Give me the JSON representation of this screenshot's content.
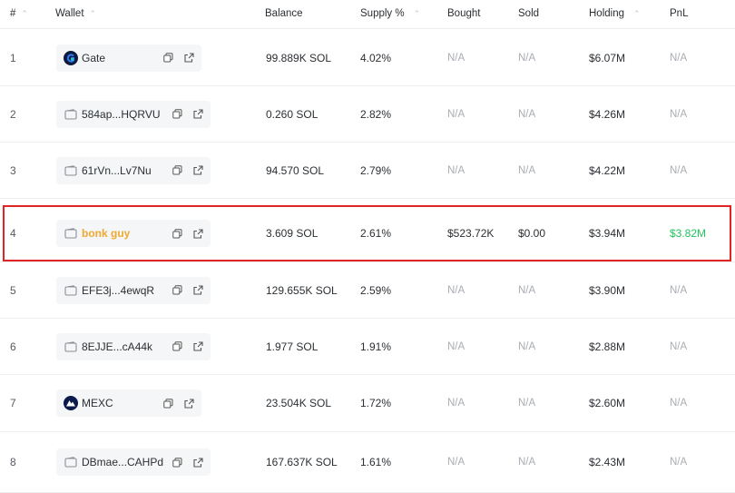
{
  "header": {
    "index": "#",
    "wallet": "Wallet",
    "balance": "Balance",
    "supply": "Supply %",
    "bought": "Bought",
    "sold": "Sold",
    "holding": "Holding",
    "pnl": "PnL"
  },
  "rows": [
    {
      "index": "1",
      "wallet": "Gate",
      "icon": "gate-logo-icon",
      "balance": "99.889K SOL",
      "supply": "4.02%",
      "bought": "N/A",
      "sold": "N/A",
      "holding": "$6.07M",
      "pnl": "N/A"
    },
    {
      "index": "2",
      "wallet": "584ap...HQRVU",
      "icon": "wallet-icon",
      "balance": "0.260 SOL",
      "supply": "2.82%",
      "bought": "N/A",
      "sold": "N/A",
      "holding": "$4.26M",
      "pnl": "N/A"
    },
    {
      "index": "3",
      "wallet": "61rVn...Lv7Nu",
      "icon": "wallet-icon",
      "balance": "94.570 SOL",
      "supply": "2.79%",
      "bought": "N/A",
      "sold": "N/A",
      "holding": "$4.22M",
      "pnl": "N/A"
    },
    {
      "index": "4",
      "wallet": "bonk guy",
      "icon": "wallet-icon",
      "balance": "3.609 SOL",
      "supply": "2.61%",
      "bought": "$523.72K",
      "sold": "$0.00",
      "holding": "$3.94M",
      "pnl": "$3.82M"
    },
    {
      "index": "5",
      "wallet": "EFE3j...4ewqR",
      "icon": "wallet-icon",
      "balance": "129.655K SOL",
      "supply": "2.59%",
      "bought": "N/A",
      "sold": "N/A",
      "holding": "$3.90M",
      "pnl": "N/A"
    },
    {
      "index": "6",
      "wallet": "8EJJE...cA44k",
      "icon": "wallet-icon",
      "balance": "1.977 SOL",
      "supply": "1.91%",
      "bought": "N/A",
      "sold": "N/A",
      "holding": "$2.88M",
      "pnl": "N/A"
    },
    {
      "index": "7",
      "wallet": "MEXC",
      "icon": "mexc-logo-icon",
      "balance": "23.504K SOL",
      "supply": "1.72%",
      "bought": "N/A",
      "sold": "N/A",
      "holding": "$2.60M",
      "pnl": "N/A"
    },
    {
      "index": "8",
      "wallet": "DBmae...CAHPd",
      "icon": "wallet-icon",
      "balance": "167.637K SOL",
      "supply": "1.61%",
      "bought": "N/A",
      "sold": "N/A",
      "holding": "$2.43M",
      "pnl": "N/A"
    }
  ],
  "colors": {
    "highlight_border": "#e02424",
    "highlight_name": "#f0a830",
    "pnl_positive": "#22c55e",
    "na_text": "#a9adb3"
  }
}
